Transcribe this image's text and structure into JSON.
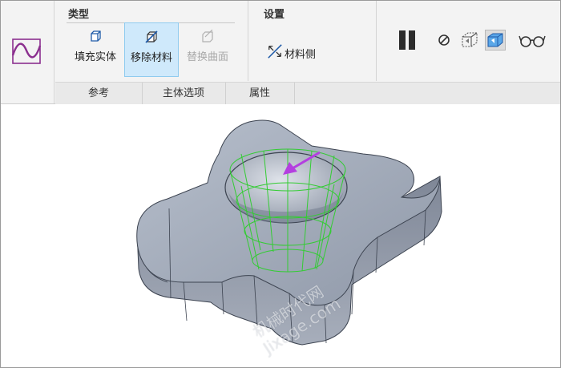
{
  "groups": {
    "type_title": "类型",
    "settings_title": "设置"
  },
  "type_buttons": [
    {
      "label": "填充实体",
      "icon": "fill-solid-icon",
      "state": "normal"
    },
    {
      "label": "移除材料",
      "icon": "remove-material-icon",
      "state": "active"
    },
    {
      "label": "替换曲面",
      "icon": "replace-surface-icon",
      "state": "disabled"
    }
  ],
  "settings": {
    "material_side_label": "材料侧",
    "material_side_icon": "material-side-arrow-icon"
  },
  "tabs": [
    {
      "label": "参考"
    },
    {
      "label": "主体选项"
    },
    {
      "label": "属性"
    }
  ],
  "right_tools": [
    {
      "icon": "pause-icon"
    },
    {
      "icon": "no-entry-icon"
    },
    {
      "icon": "geometry-preview-icon"
    },
    {
      "icon": "feature-preview-icon",
      "selected": true
    },
    {
      "icon": "glasses-verify-icon"
    }
  ],
  "watermark": {
    "line1": "机械时代网",
    "line2": "Jixage.com"
  },
  "colors": {
    "accent_active": "#cfe9fb",
    "model_fill": "#8e97a7",
    "sketch_green": "#33cc33",
    "arrow_purple": "#b43fe0",
    "sketch_icon": "#8b2f8f"
  }
}
